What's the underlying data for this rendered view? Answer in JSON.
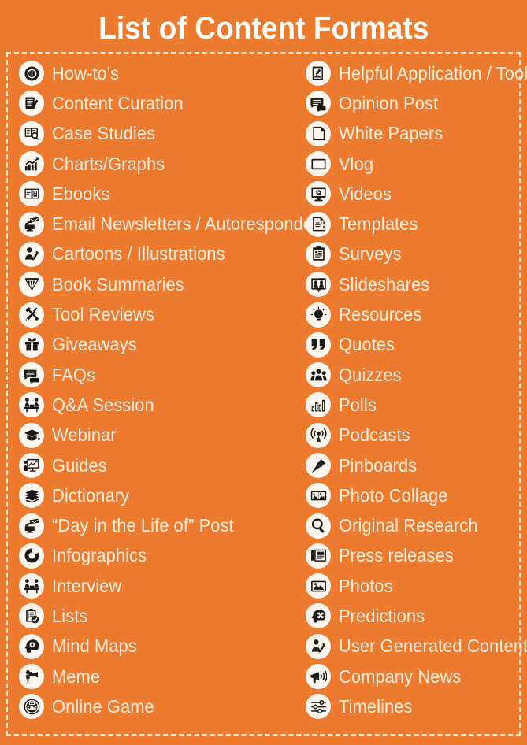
{
  "header": {
    "title": "List of Content Formats"
  },
  "colors": {
    "background": "#ED7B2F",
    "text": "#FBEFE2",
    "title": "#FFFDF8",
    "bullet_fill": "#FCF6EE",
    "icon": "#1A1A1A",
    "border": "#F8E9DC"
  },
  "columns": {
    "left": [
      {
        "label": "How-to's",
        "icon": "info-circle-icon"
      },
      {
        "label": "Content Curation",
        "icon": "notepad-pencil-icon"
      },
      {
        "label": "Case Studies",
        "icon": "book-magnifier-icon"
      },
      {
        "label": "Charts/Graphs",
        "icon": "bar-chart-arrow-icon"
      },
      {
        "label": "Ebooks",
        "icon": "open-book-icon"
      },
      {
        "label": "Email Newsletters / Autoresponders",
        "icon": "monitor-hand-letter-icon"
      },
      {
        "label": "Cartoons / Illustrations",
        "icon": "person-drawing-icon"
      },
      {
        "label": "Book Summaries",
        "icon": "book-pages-funnel-icon"
      },
      {
        "label": "Tool Reviews",
        "icon": "wrench-screwdriver-icon"
      },
      {
        "label": "Giveaways",
        "icon": "gift-box-icon"
      },
      {
        "label": "FAQs",
        "icon": "speech-bubbles-icon"
      },
      {
        "label": "Q&A Session",
        "icon": "two-people-table-icon"
      },
      {
        "label": "Webinar",
        "icon": "graduation-cap-icon"
      },
      {
        "label": "Guides",
        "icon": "presenter-board-icon"
      },
      {
        "label": "Dictionary",
        "icon": "stacked-books-icon"
      },
      {
        "label": "“Day in the Life of” Post",
        "icon": "monitor-hand-letter-icon"
      },
      {
        "label": "Infographics",
        "icon": "pie-donut-icon"
      },
      {
        "label": "Interview",
        "icon": "two-people-table-icon"
      },
      {
        "label": "Lists",
        "icon": "clipboard-check-icon"
      },
      {
        "label": "Mind Maps",
        "icon": "head-gears-icon"
      },
      {
        "label": "Meme",
        "icon": "person-camera-icon"
      },
      {
        "label": "Online Game",
        "icon": "gamepad-circle-icon"
      }
    ],
    "right": [
      {
        "label": "Helpful Application / Tool",
        "icon": "microscope-document-icon"
      },
      {
        "label": "Opinion Post",
        "icon": "speech-bubbles-icon"
      },
      {
        "label": "White Papers",
        "icon": "document-page-icon"
      },
      {
        "label": "Vlog",
        "icon": "screen-icon"
      },
      {
        "label": "Videos",
        "icon": "monitor-play-icon"
      },
      {
        "label": "Templates",
        "icon": "document-lines-icon"
      },
      {
        "label": "Surveys",
        "icon": "clipboard-lines-icon"
      },
      {
        "label": "Slideshares",
        "icon": "projector-screen-people-icon"
      },
      {
        "label": "Resources",
        "icon": "lightbulb-icon"
      },
      {
        "label": "Quotes",
        "icon": "quotation-marks-icon"
      },
      {
        "label": "Quizzes",
        "icon": "group-people-icon"
      },
      {
        "label": "Polls",
        "icon": "bar-chart-icon"
      },
      {
        "label": "Podcasts",
        "icon": "broadcast-mic-icon"
      },
      {
        "label": "Pinboards",
        "icon": "push-pin-icon"
      },
      {
        "label": "Photo Collage",
        "icon": "photo-frames-icon"
      },
      {
        "label": "Original Research",
        "icon": "magnifier-icon"
      },
      {
        "label": "Press releases",
        "icon": "newspaper-icon"
      },
      {
        "label": "Photos",
        "icon": "picture-mountain-icon"
      },
      {
        "label": "Predictions",
        "icon": "head-puzzle-icon"
      },
      {
        "label": "User Generated Content",
        "icon": "person-drawing-icon"
      },
      {
        "label": "Company News",
        "icon": "megaphone-icon"
      },
      {
        "label": "Timelines",
        "icon": "sliders-icon"
      }
    ]
  }
}
